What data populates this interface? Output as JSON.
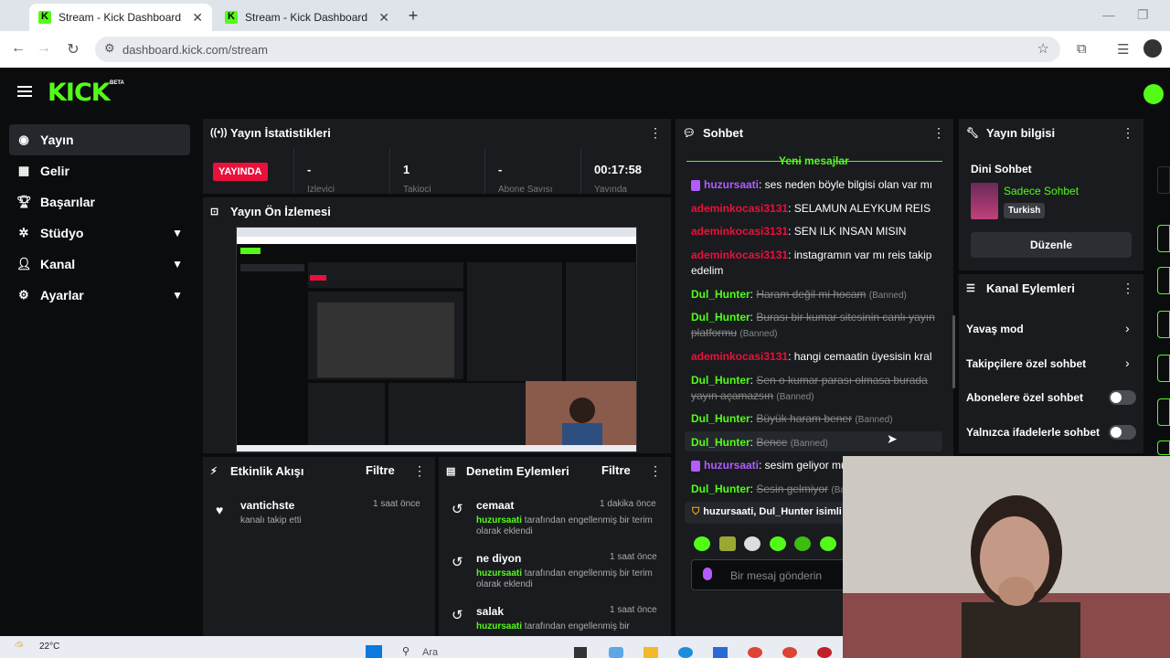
{
  "browser": {
    "tabs": [
      {
        "title": "Stream - Kick Dashboard"
      },
      {
        "title": "Stream - Kick Dashboard"
      }
    ],
    "url": "dashboard.kick.com/stream"
  },
  "header": {
    "logo": "KICK",
    "beta": "BETA"
  },
  "sidebar": {
    "items": [
      {
        "label": "Yayın",
        "icon": "broadcast-icon"
      },
      {
        "label": "Gelir",
        "icon": "chart-icon"
      },
      {
        "label": "Başarılar",
        "icon": "trophy-icon"
      },
      {
        "label": "Stüdyo",
        "icon": "studio-icon"
      },
      {
        "label": "Kanal",
        "icon": "user-icon"
      },
      {
        "label": "Ayarlar",
        "icon": "gear-icon"
      }
    ]
  },
  "stats": {
    "title": "Yayın İstatistikleri",
    "live": "YAYINDA",
    "viewers": "-",
    "followers": "1",
    "subs": "-",
    "uptime": "00:17:58",
    "label_viewers": "İzleyici",
    "label_followers": "Takipçi",
    "label_subs": "Abone Sayısı",
    "label_uptime": "Yayında"
  },
  "preview": {
    "title": "Yayın Ön İzlemesi"
  },
  "activity": {
    "title": "Etkinlik Akışı",
    "filter": "Filtre",
    "items": [
      {
        "user": "vantichste",
        "text": "kanalı takip etti",
        "time": "1 saat önce"
      }
    ]
  },
  "moderation": {
    "title": "Denetim Eylemleri",
    "filter": "Filtre",
    "items": [
      {
        "word": "cemaat",
        "time": "1 dakika önce",
        "by": "huzursaati",
        "text": " tarafından engellenmiş bir terim olarak eklendi"
      },
      {
        "word": "ne diyon",
        "time": "1 saat önce",
        "by": "huzursaati",
        "text": " tarafından engellenmiş bir terim olarak eklendi"
      },
      {
        "word": "salak",
        "time": "1 saat önce",
        "by": "huzursaati",
        "text": " tarafından engellenmiş bir"
      }
    ]
  },
  "chat": {
    "title": "Sohbet",
    "new_messages": "Yeni mesajlar",
    "messages": [
      {
        "user": "huzursaati",
        "text": ": ses neden böyle bilgisi olan var mı"
      },
      {
        "user": "ademinkocasi3131",
        "text": ": SELAMUN ALEYKUM REIS"
      },
      {
        "user": "ademinkocasi3131",
        "text": ": SEN ILK INSAN MISIN"
      },
      {
        "user": "ademinkocasi3131",
        "text": ": instagramın var mı reis takip edelim"
      },
      {
        "user": "Dul_Hunter",
        "text": "Haram değil mi hocam",
        "tag": "(Banned)"
      },
      {
        "user": "Dul_Hunter",
        "text": "Burası bir kumar sitesinin canlı yayın platformu",
        "tag": "(Banned)"
      },
      {
        "user": "ademinkocasi3131",
        "text": ": hangi cemaatin üyesisin kral"
      },
      {
        "user": "Dul_Hunter",
        "text": "Sen o kumar parası olmasa burada yayın açamazsın",
        "tag": "(Banned)"
      },
      {
        "user": "Dul_Hunter",
        "text": "Büyük haram bener",
        "tag": "(Banned)"
      },
      {
        "user": "Dul_Hunter",
        "text": "Bence",
        "tag": "(Banned)"
      },
      {
        "user": "huzursaati",
        "text": ": sesim geliyor mu"
      },
      {
        "user": "Dul_Hunter",
        "text": "Sesin gelmiyor",
        "tag": "(Ban"
      }
    ],
    "system": "huzursaati, Dul_Hunter isimli k",
    "placeholder": "Bir mesaj gönderin"
  },
  "stream_info": {
    "title": "Yayın bilgisi",
    "category": "Dini Sohbet",
    "mode": "Sadece Sohbet",
    "language": "Turkish",
    "edit": "Düzenle"
  },
  "channel_actions": {
    "title": "Kanal Eylemleri",
    "items": [
      {
        "label": "Yavaş mod"
      },
      {
        "label": "Takipçilere özel sohbet"
      },
      {
        "label": "Abonelere özel sohbet"
      },
      {
        "label": "Yalnızca ifadelerle sohbet"
      }
    ]
  },
  "taskbar": {
    "temp": "22°C",
    "search": "Ara"
  }
}
